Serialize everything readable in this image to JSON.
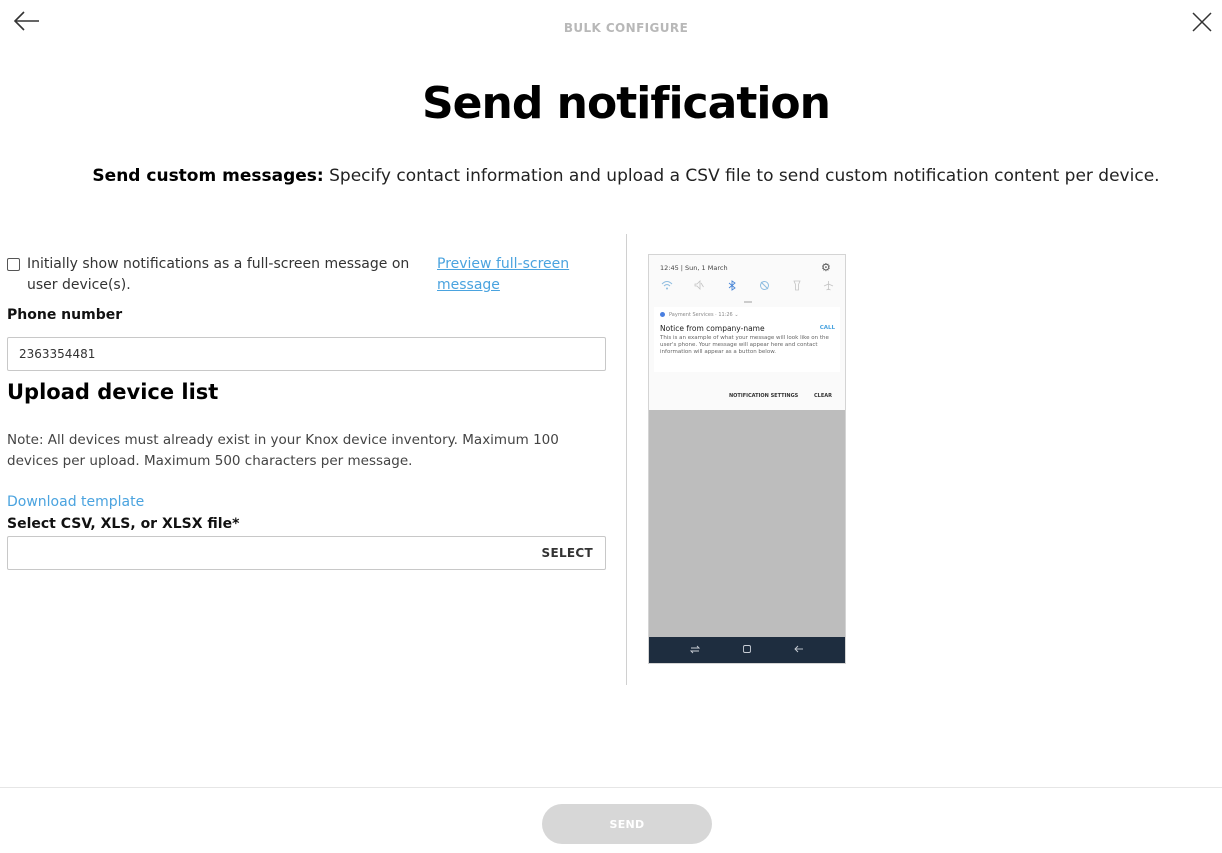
{
  "header": {
    "label": "BULK CONFIGURE"
  },
  "page": {
    "title": "Send notification",
    "subtitle_bold": "Send custom messages:",
    "subtitle_text": "Specify contact information and upload a CSV file to send custom notification content per device."
  },
  "form": {
    "fullscreen_checkbox_label": "Initially show notifications as a full-screen message on user device(s).",
    "fullscreen_checked": false,
    "preview_link": "Preview full-screen message",
    "phone_label": "Phone number",
    "phone_value": "2363354481",
    "upload_heading": "Upload device list",
    "note": "Note: All devices must already exist in your Knox device inventory. Maximum 100 devices per upload. Maximum 500 characters per message.",
    "download_template": "Download template",
    "file_label": "Select CSV, XLS, or XLSX file*",
    "select_button": "SELECT"
  },
  "preview": {
    "status_time": "12:45  |  Sun, 1 March",
    "notification_app": "Payment Services  ·  11:26  ⌄",
    "notification_title": "Notice from company-name",
    "notification_body": "This is an example of what your message will look like on the user's phone. Your message will appear here and contact information will appear as a button below.",
    "call_action": "CALL",
    "settings_action": "NOTIFICATION SETTINGS",
    "clear_action": "CLEAR"
  },
  "footer": {
    "send_button": "SEND"
  },
  "colors": {
    "link": "#4aa3df",
    "send_disabled": "#d7d7d7",
    "nav_bar": "#1e2d3f"
  }
}
